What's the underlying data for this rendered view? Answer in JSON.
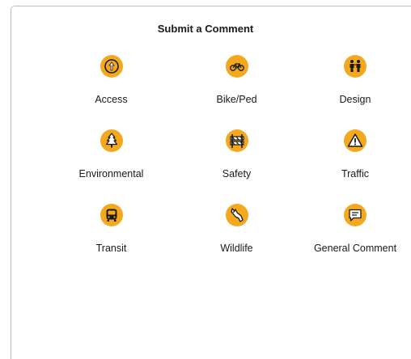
{
  "form": {
    "title": "Submit a Comment"
  },
  "categories": [
    {
      "label": "Access",
      "icon": "upward-arrow-icon"
    },
    {
      "label": "Bike/Ped",
      "icon": "bicycle-icon"
    },
    {
      "label": "Design",
      "icon": "people-icon"
    },
    {
      "label": "Environmental",
      "icon": "tree-icon"
    },
    {
      "label": "Safety",
      "icon": "road-barrier-icon"
    },
    {
      "label": "Traffic",
      "icon": "warning-triangle-icon"
    },
    {
      "label": "Transit",
      "icon": "bus-icon"
    },
    {
      "label": "Wildlife",
      "icon": "animal-icon"
    },
    {
      "label": "General Comment",
      "icon": "speech-bubble-icon"
    }
  ],
  "colors": {
    "icon_fill": "#f4a81e",
    "icon_glyph": "#1a1a1a",
    "panel_border": "#b5bfcb"
  }
}
